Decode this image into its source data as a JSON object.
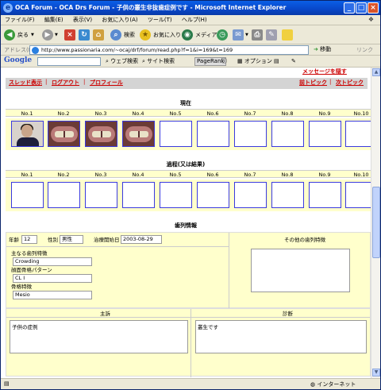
{
  "window": {
    "title": "OCA Forum - OCA Drs Forum - 子供の叢生非抜歯症例です - Microsoft Internet Explorer"
  },
  "menu": [
    "ファイル(F)",
    "編集(E)",
    "表示(V)",
    "お気に入り(A)",
    "ツール(T)",
    "ヘルプ(H)"
  ],
  "toolbar": {
    "back": "戻る",
    "search": "検索",
    "favorites": "お気に入り",
    "media": "メディア"
  },
  "address": {
    "label": "アドレス(D)",
    "url": "http://www.passionaria.com/~ocaj/drf/forum/read.php?f=1&i=169&t=169",
    "go": "移動",
    "links": "リンク"
  },
  "google": {
    "logo": "Google",
    "web_search": "ウェブ検索",
    "site_search": "サイト検索",
    "pagerank": "PageRank",
    "options": "オプション"
  },
  "nav": {
    "top_notice": "メッセージを隠す",
    "thread": "スレッド表示",
    "logout": "ログアウト",
    "profile": "プロフィール",
    "prev": "前トピック",
    "next": "次トピック"
  },
  "current": {
    "heading": "現在",
    "columns": [
      "No.1",
      "No.2",
      "No.3",
      "No.4",
      "No.5",
      "No.6",
      "No.7",
      "No.8",
      "No.9",
      "No.10"
    ]
  },
  "progress": {
    "heading": "過程(又は結果)",
    "columns": [
      "No.1",
      "No.2",
      "No.3",
      "No.4",
      "No.5",
      "No.6",
      "No.7",
      "No.8",
      "No.9",
      "No.10"
    ]
  },
  "dental": {
    "heading": "歯列情報",
    "age_label": "年齢",
    "age_value": "12",
    "sex_label": "性別",
    "sex_value": "男性",
    "start_label": "治療開始日",
    "start_value": "2003-08-29",
    "other_label": "その他の歯列特徴",
    "main_feature_label": "主なる歯列特徴",
    "main_feature_value": "Crowding",
    "pattern_label": "顔面骨格パターン",
    "pattern_value": "CL I",
    "skeletal_label": "骨格特徴",
    "skeletal_value": "Mesio"
  },
  "complaint": {
    "label": "主訴",
    "value": "子供の症例"
  },
  "diagnosis": {
    "label": "診断",
    "value": "叢生です"
  },
  "status": {
    "zone": "インターネット"
  }
}
